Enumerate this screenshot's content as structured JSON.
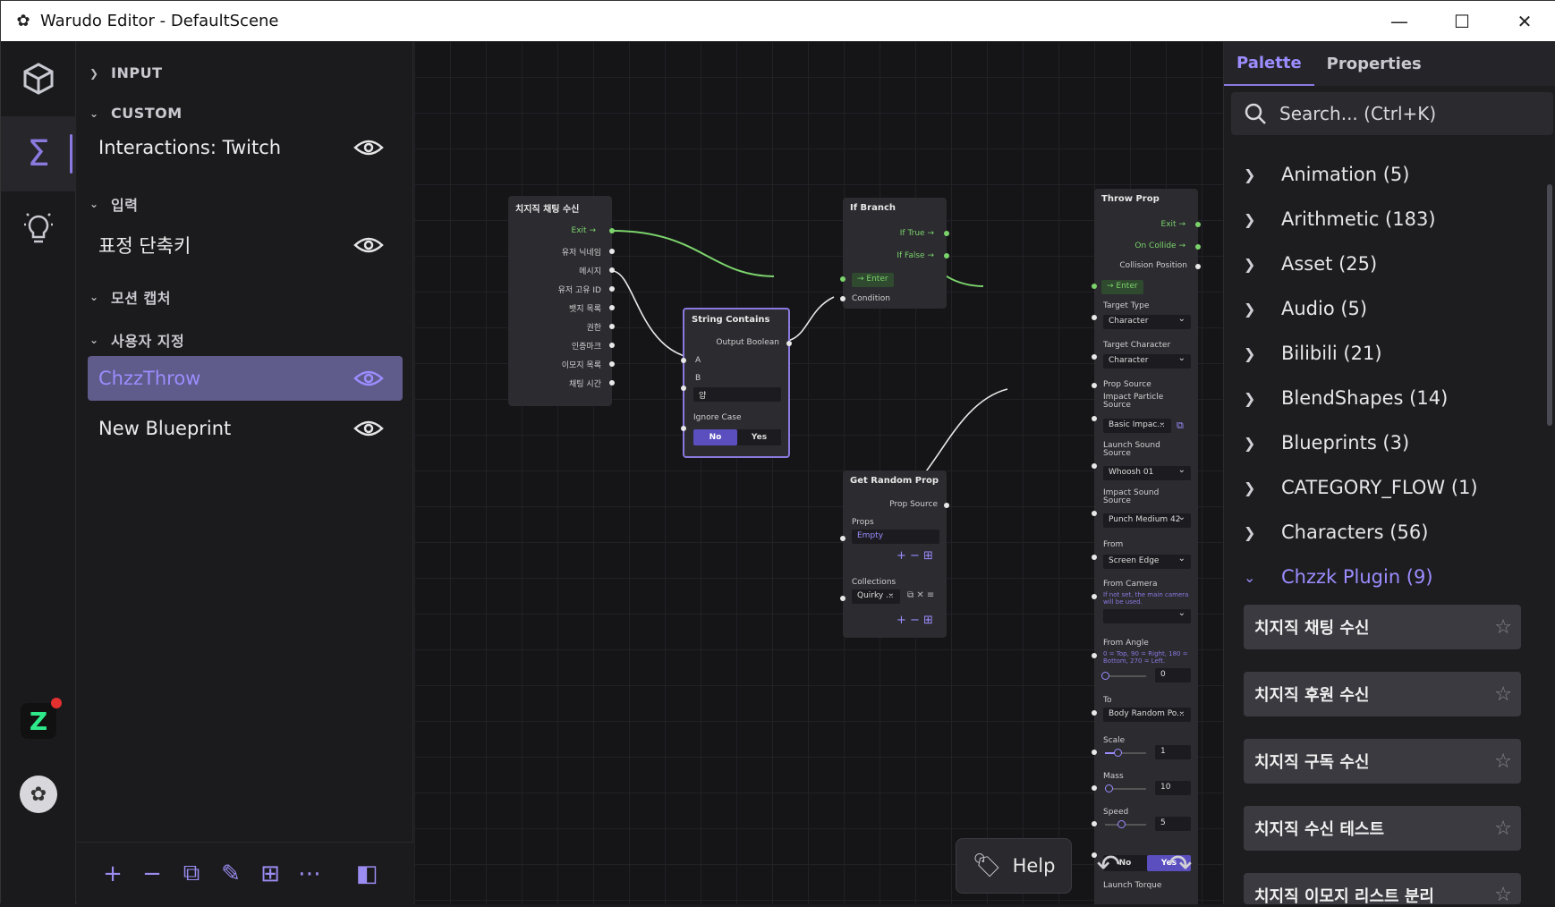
{
  "window": {
    "title": "Warudo Editor - DefaultScene"
  },
  "sidebar": {
    "categories": [
      "INPUT",
      "CUSTOM",
      "입력",
      "모션 캡처",
      "사용자 지정"
    ],
    "items": [
      {
        "label": "Interactions: Twitch"
      },
      {
        "label": "표정 단축키"
      },
      {
        "label": "ChzzThrow"
      },
      {
        "label": "New Blueprint"
      }
    ]
  },
  "canvas": {
    "chat_node": {
      "title": "치지직 채팅 수신",
      "exit": "Exit",
      "outputs": [
        "유저 닉네임",
        "메시지",
        "유저 고유 ID",
        "뱃지 목록",
        "권한",
        "인증마크",
        "이모지 목록",
        "채팅 시간"
      ]
    },
    "string_node": {
      "title": "String Contains",
      "output": "Output Boolean",
      "a": "A",
      "b": "B",
      "b_value": "얍",
      "ignore_case": "Ignore Case",
      "no": "No",
      "yes": "Yes"
    },
    "if_node": {
      "title": "If Branch",
      "if_true": "If True",
      "if_false": "If False",
      "enter": "Enter",
      "condition": "Condition"
    },
    "random_node": {
      "title": "Get Random Prop",
      "prop_source": "Prop Source",
      "props": "Props",
      "empty": "Empty",
      "collections": "Collections",
      "quirky": "Quirky ..."
    },
    "throw_node": {
      "title": "Throw Prop",
      "exit": "Exit",
      "on_collide": "On Collide",
      "collision_position": "Collision Position",
      "enter": "Enter",
      "target_type": "Target Type",
      "target_type_value": "Character",
      "target_character": "Target Character",
      "target_character_value": "Character",
      "prop_source": "Prop Source",
      "impact_particle": "Impact Particle Source",
      "impact_particle_value": "Basic Impac...",
      "launch_sound": "Launch Sound Source",
      "launch_sound_value": "Whoosh 01",
      "impact_sound": "Impact Sound Source",
      "impact_sound_value": "Punch Medium 42",
      "from": "From",
      "from_value": "Screen Edge",
      "from_camera": "From Camera",
      "from_camera_hint": "If not set, the main camera will be used.",
      "from_angle": "From Angle",
      "from_angle_hint": "0 = Top, 90 = Right, 180 = Bottom, 270 = Left.",
      "from_angle_value": "0",
      "to": "To",
      "to_value": "Body Random Po...",
      "scale": "Scale",
      "scale_value": "1",
      "mass": "Mass",
      "mass_value": "10",
      "speed": "Speed",
      "speed_value": "5",
      "no": "No",
      "yes": "Yes",
      "launch_torque": "Launch Torque"
    },
    "help_label": "Help"
  },
  "panel": {
    "tabs": [
      "Palette",
      "Properties"
    ],
    "search_placeholder": "Search... (Ctrl+K)",
    "categories": [
      "Animation (5)",
      "Arithmetic (183)",
      "Asset (25)",
      "Audio (5)",
      "Bilibili (21)",
      "BlendShapes (14)",
      "Blueprints (3)",
      "CATEGORY_FLOW (1)",
      "Characters (56)",
      "Chzzk Plugin (9)"
    ],
    "plugin_items": [
      "치지직 채팅 수신",
      "치지직 후원 수신",
      "치지직 구독 수신",
      "치지직 수신 테스트",
      "치지직 이모지 리스트 분리"
    ]
  },
  "colors": {
    "accent": "#8a7ae0",
    "flow": "#7cd36b",
    "selected_item": "#5f5b8a"
  }
}
